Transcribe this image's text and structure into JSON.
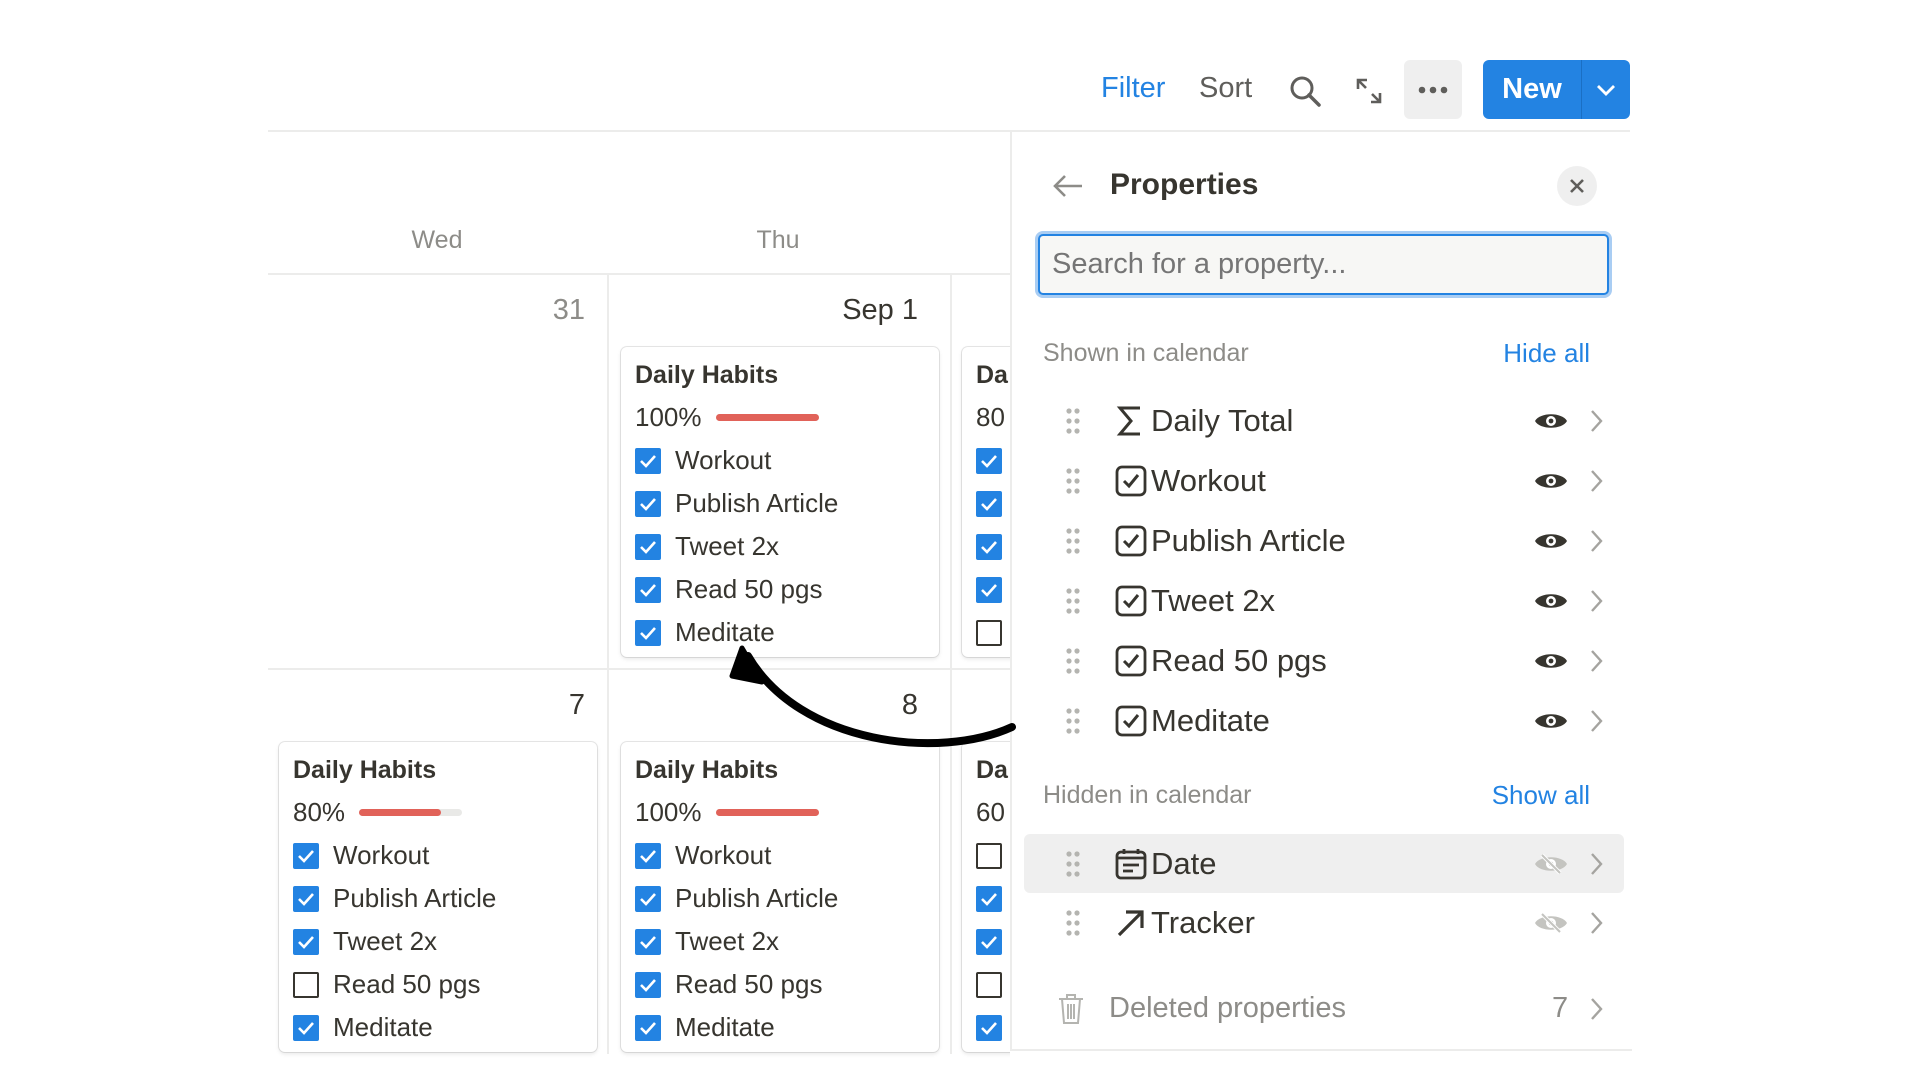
{
  "toolbar": {
    "filter": "Filter",
    "sort": "Sort",
    "new": "New",
    "icons": [
      "search-icon",
      "expand-icon",
      "more-icon",
      "chevron-down-icon"
    ]
  },
  "calendar": {
    "day_headers": [
      "Wed",
      "Thu"
    ],
    "rows": [
      {
        "dates": [
          "31",
          "Sep 1",
          ""
        ],
        "cards": [
          null,
          {
            "title": "Daily Habits",
            "percent": "100%",
            "progress": 1.0,
            "items": [
              {
                "label": "Workout",
                "checked": true
              },
              {
                "label": "Publish Article",
                "checked": true
              },
              {
                "label": "Tweet 2x",
                "checked": true
              },
              {
                "label": "Read 50 pgs",
                "checked": true
              },
              {
                "label": "Meditate",
                "checked": true
              }
            ]
          },
          {
            "title": "Da",
            "percent": "80",
            "progress": 0.8,
            "items": [
              {
                "label": "",
                "checked": true
              },
              {
                "label": "",
                "checked": true
              },
              {
                "label": "",
                "checked": true
              },
              {
                "label": "",
                "checked": true
              },
              {
                "label": "",
                "checked": false
              }
            ]
          }
        ]
      },
      {
        "dates": [
          "7",
          "8",
          ""
        ],
        "cards": [
          {
            "title": "Daily Habits",
            "percent": "80%",
            "progress": 0.8,
            "items": [
              {
                "label": "Workout",
                "checked": true
              },
              {
                "label": "Publish Article",
                "checked": true
              },
              {
                "label": "Tweet 2x",
                "checked": true
              },
              {
                "label": "Read 50 pgs",
                "checked": false
              },
              {
                "label": "Meditate",
                "checked": true
              }
            ]
          },
          {
            "title": "Daily Habits",
            "percent": "100%",
            "progress": 1.0,
            "items": [
              {
                "label": "Workout",
                "checked": true
              },
              {
                "label": "Publish Article",
                "checked": true
              },
              {
                "label": "Tweet 2x",
                "checked": true
              },
              {
                "label": "Read 50 pgs",
                "checked": true
              },
              {
                "label": "Meditate",
                "checked": true
              }
            ]
          },
          {
            "title": "Da",
            "percent": "60",
            "progress": 0.6,
            "items": [
              {
                "label": "",
                "checked": false
              },
              {
                "label": "",
                "checked": true
              },
              {
                "label": "",
                "checked": true
              },
              {
                "label": "",
                "checked": false
              },
              {
                "label": "",
                "checked": true
              }
            ]
          }
        ]
      }
    ]
  },
  "panel": {
    "title": "Properties",
    "search_placeholder": "Search for a property...",
    "shown_heading": "Shown in calendar",
    "hide_all": "Hide all",
    "shown": [
      {
        "label": "Daily Total",
        "icon": "sigma-icon"
      },
      {
        "label": "Workout",
        "icon": "checkbox-icon"
      },
      {
        "label": "Publish Article",
        "icon": "checkbox-icon"
      },
      {
        "label": "Tweet 2x",
        "icon": "checkbox-icon"
      },
      {
        "label": "Read 50 pgs",
        "icon": "checkbox-icon"
      },
      {
        "label": "Meditate",
        "icon": "checkbox-icon"
      }
    ],
    "hidden_heading": "Hidden in calendar",
    "show_all": "Show all",
    "hidden": [
      {
        "label": "Date",
        "icon": "calendar-icon"
      },
      {
        "label": "Tracker",
        "icon": "arrow-up-right-icon"
      }
    ],
    "deleted_label": "Deleted properties",
    "deleted_count": "7"
  },
  "colors": {
    "accent": "#2383e2",
    "progress": "#e16259"
  }
}
